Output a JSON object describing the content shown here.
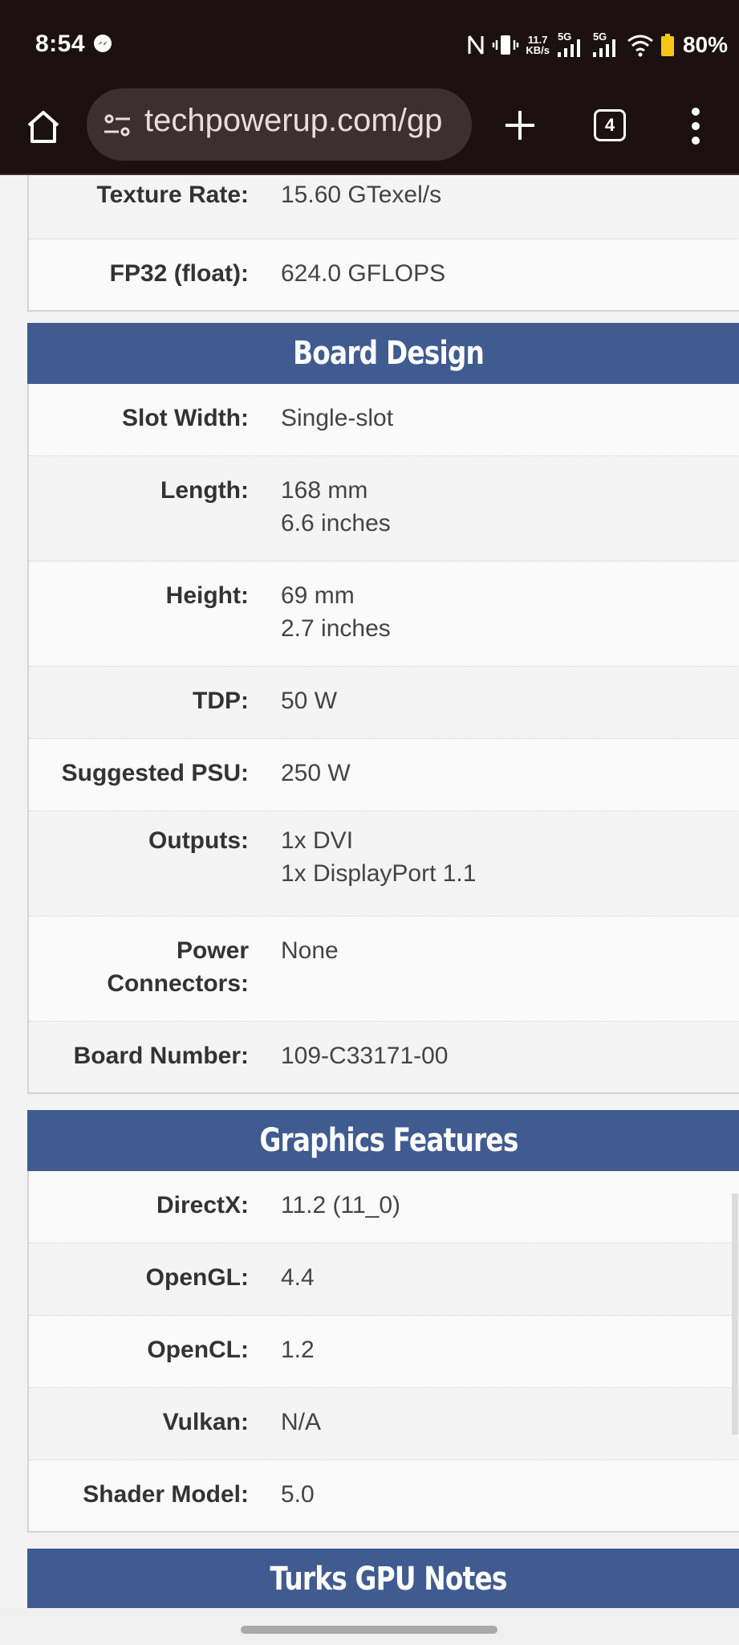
{
  "status_bar": {
    "time": "8:54",
    "net_speed_top": "11.7",
    "net_speed_bottom": "KB/s",
    "sig1_label": "5G",
    "sig2_label": "5G",
    "battery": "80%"
  },
  "browser": {
    "url": "techpowerup.com/gp",
    "tab_count": "4"
  },
  "colors": {
    "section_header": "#3f5b90",
    "chrome_bg": "#1c1010"
  },
  "top_rows": [
    {
      "label": "Texture Rate:",
      "value": "15.60 GTexel/s"
    },
    {
      "label": "FP32 (float):",
      "value": "624.0 GFLOPS"
    }
  ],
  "board_design": {
    "title": "Board Design",
    "rows": [
      {
        "label": "Slot Width:",
        "value": "Single-slot"
      },
      {
        "label": "Length:",
        "value": "168 mm\n6.6 inches"
      },
      {
        "label": "Height:",
        "value": "69 mm\n2.7 inches"
      },
      {
        "label": "TDP:",
        "value": "50 W"
      },
      {
        "label": "Suggested PSU:",
        "value": "250 W"
      },
      {
        "label": "Outputs:",
        "value": "1x DVI\n1x DisplayPort 1.1"
      },
      {
        "label": "Power\nConnectors:",
        "value": "None"
      },
      {
        "label": "Board Number:",
        "value": "109-C33171-00"
      }
    ]
  },
  "graphics_features": {
    "title": "Graphics Features",
    "rows": [
      {
        "label": "DirectX:",
        "value": "11.2 (11_0)"
      },
      {
        "label": "OpenGL:",
        "value": "4.4"
      },
      {
        "label": "OpenCL:",
        "value": "1.2"
      },
      {
        "label": "Vulkan:",
        "value": "N/A"
      },
      {
        "label": "Shader Model:",
        "value": "5.0"
      }
    ]
  },
  "gpu_notes": {
    "title": "Turks GPU Notes"
  }
}
